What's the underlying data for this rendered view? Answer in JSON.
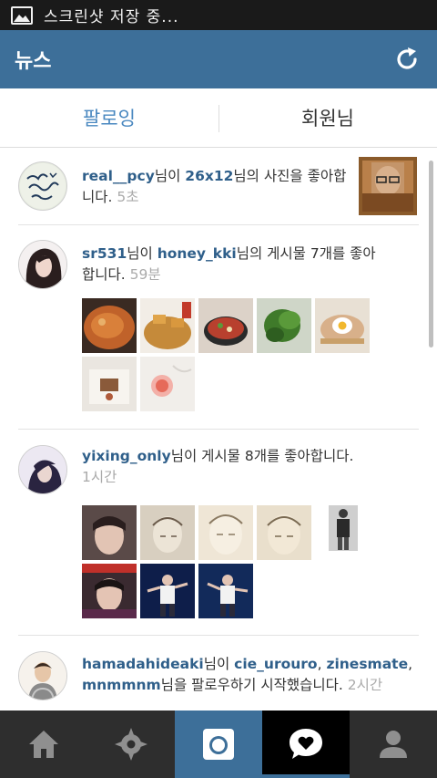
{
  "status_bar": {
    "text": "스크린샷 저장 중..."
  },
  "app_bar": {
    "title": "뉴스"
  },
  "tabs": [
    {
      "label": "팔로잉"
    },
    {
      "label": "회원님"
    }
  ],
  "feed": [
    {
      "user": "real__pcy",
      "parts": [
        "님이 ",
        "26x12",
        "님의 사진을 좋아합니다."
      ],
      "time": "5초"
    },
    {
      "user": "sr531",
      "parts": [
        "님이 ",
        "honey_kki",
        "님의 게시물 7개를 좋아합니다."
      ],
      "time": "59분"
    },
    {
      "user": "yixing_only",
      "parts": [
        "님이 게시물 8개를 좋아합니다."
      ],
      "time": "1시간"
    },
    {
      "user": "hamadahideaki",
      "parts": [
        "님이 ",
        "cie_urouro",
        ", ",
        "zinesmate",
        ", ",
        "mnmmnm",
        "님을 팔로우하기 시작했습니다."
      ],
      "time": "2시간"
    }
  ],
  "colors": {
    "accent": "#3d6f99",
    "tab_active": "#4a88c0",
    "username": "#2f5f8a",
    "timestamp": "#aaaaaa"
  },
  "nav": [
    {
      "icon": "home-icon"
    },
    {
      "icon": "explore-icon"
    },
    {
      "icon": "camera-icon"
    },
    {
      "icon": "news-heart-icon",
      "selected": true
    },
    {
      "icon": "profile-icon"
    }
  ]
}
